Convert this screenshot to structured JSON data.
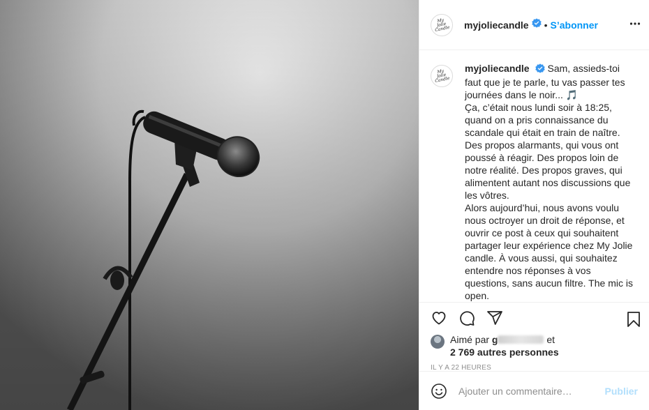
{
  "post": {
    "username": "myjoliecandle",
    "avatar_logo_lines": [
      "My",
      "Jolie",
      "Candle"
    ],
    "follow_label": "S’abonner",
    "separator": "•",
    "verified_color": "#3897f0",
    "accent_color": "#0095f6"
  },
  "caption": {
    "paragraphs": [
      "Sam, assieds-toi faut que je te parle, tu vas passer tes journées dans le noir... 🎵",
      "Ça, c’était nous lundi soir à 18:25, quand on a pris connaissance du scandale qui était en train de naître. Des propos alarmants, qui vous ont poussé à réagir. Des propos loin de notre réalité. Des propos graves, qui alimentent autant nos discussions que les vôtres.",
      "Alors aujourd’hui, nous avons voulu nous octroyer un droit de réponse, et ouvrir ce post à ceux qui souhaitent partager leur expérience chez My Jolie candle. À vous aussi, qui souhaitez entendre nos réponses à vos questions, sans aucun filtre. The mic is open."
    ]
  },
  "likes": {
    "prefix": "Aimé par",
    "liker_visible": "g",
    "connector": "et",
    "others": "2 769 autres personnes"
  },
  "timestamp": "IL Y A 22 HEURES",
  "comment_box": {
    "placeholder": "Ajouter un commentaire…",
    "publish_label": "Publier"
  },
  "icons": {
    "like": "heart-icon",
    "comment": "comment-icon",
    "share": "share-icon",
    "save": "bookmark-icon",
    "more": "more-options-icon",
    "emoji": "emoji-icon",
    "verified": "verified-badge-icon"
  }
}
